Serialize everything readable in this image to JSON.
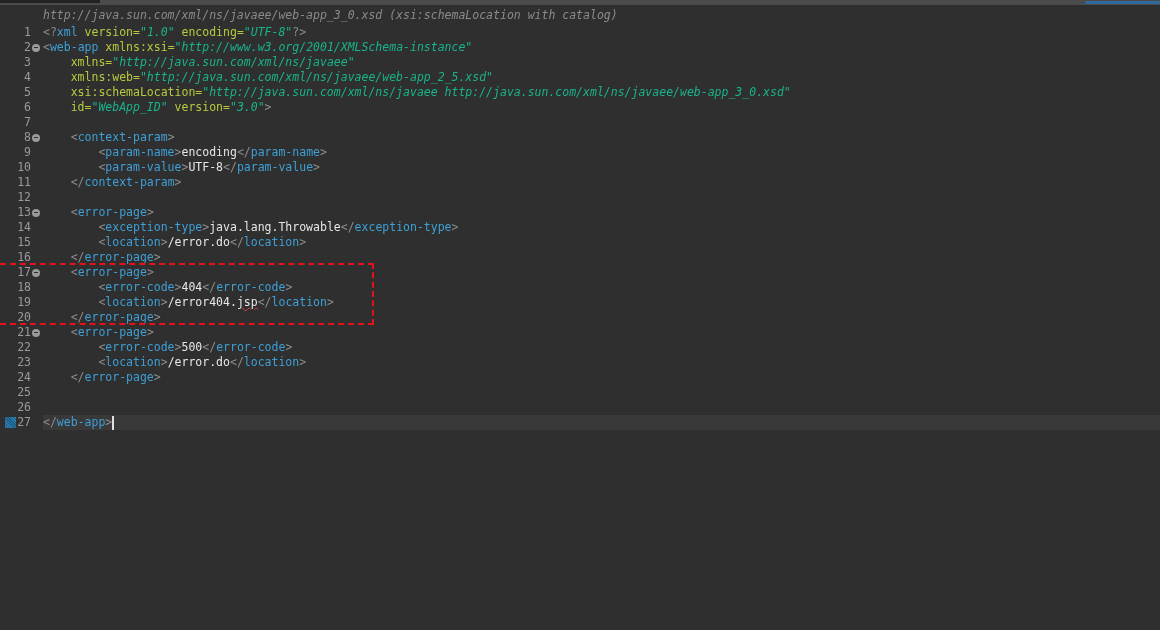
{
  "editor": {
    "hint": "http://java.sun.com/xml/ns/javaee/web-app_3_0.xsd (xsi:schemaLocation with catalog)",
    "lines": [
      {
        "number": "1",
        "foldable": false,
        "current": false,
        "bookmark": false,
        "tokens": [
          {
            "kind": "punct",
            "text": "<?"
          },
          {
            "kind": "tag",
            "text": "xml"
          },
          {
            "kind": "attr",
            "text": " version="
          },
          {
            "kind": "value",
            "text": "\"1.0\""
          },
          {
            "kind": "attr",
            "text": " encoding="
          },
          {
            "kind": "value",
            "text": "\"UTF-8\""
          },
          {
            "kind": "punct",
            "text": "?>"
          }
        ]
      },
      {
        "number": "2",
        "foldable": true,
        "current": false,
        "bookmark": false,
        "tokens": [
          {
            "kind": "punct",
            "text": "<"
          },
          {
            "kind": "tag",
            "text": "web-app"
          },
          {
            "kind": "attr",
            "text": " xmlns:xsi="
          },
          {
            "kind": "value",
            "text": "\"http://www.w3.org/2001/XMLSchema-instance\""
          }
        ]
      },
      {
        "number": "3",
        "foldable": false,
        "current": false,
        "bookmark": false,
        "tokens": [
          {
            "kind": "attr",
            "text": "    xmlns="
          },
          {
            "kind": "value",
            "text": "\"http://java.sun.com/xml/ns/javaee\""
          }
        ]
      },
      {
        "number": "4",
        "foldable": false,
        "current": false,
        "bookmark": false,
        "tokens": [
          {
            "kind": "attr",
            "text": "    xmlns:web="
          },
          {
            "kind": "value",
            "text": "\"http://java.sun.com/xml/ns/javaee/web-app_2_5.xsd\""
          }
        ]
      },
      {
        "number": "5",
        "foldable": false,
        "current": false,
        "bookmark": false,
        "tokens": [
          {
            "kind": "attr",
            "text": "    xsi:schemaLocation="
          },
          {
            "kind": "value",
            "text": "\"http://java.sun.com/xml/ns/javaee http://java.sun.com/xml/ns/javaee/web-app_3_0.xsd\""
          }
        ]
      },
      {
        "number": "6",
        "foldable": false,
        "current": false,
        "bookmark": false,
        "tokens": [
          {
            "kind": "attr",
            "text": "    id="
          },
          {
            "kind": "value",
            "text": "\"WebApp_ID\""
          },
          {
            "kind": "attr",
            "text": " version="
          },
          {
            "kind": "value",
            "text": "\"3.0\""
          },
          {
            "kind": "punct",
            "text": ">"
          }
        ]
      },
      {
        "number": "7",
        "foldable": false,
        "current": false,
        "bookmark": false
      },
      {
        "number": "8",
        "foldable": true,
        "current": false,
        "bookmark": false,
        "tokens": [
          {
            "kind": "punct",
            "text": "    <"
          },
          {
            "kind": "tag",
            "text": "context-param"
          },
          {
            "kind": "punct",
            "text": ">"
          }
        ]
      },
      {
        "number": "9",
        "foldable": false,
        "current": false,
        "bookmark": false,
        "tokens": [
          {
            "kind": "punct",
            "text": "        <"
          },
          {
            "kind": "tag",
            "text": "param-name"
          },
          {
            "kind": "punct",
            "text": ">"
          },
          {
            "kind": "text",
            "text": "encoding"
          },
          {
            "kind": "punct",
            "text": "</"
          },
          {
            "kind": "tag",
            "text": "param-name"
          },
          {
            "kind": "punct",
            "text": ">"
          }
        ]
      },
      {
        "number": "10",
        "foldable": false,
        "current": false,
        "bookmark": false,
        "tokens": [
          {
            "kind": "punct",
            "text": "        <"
          },
          {
            "kind": "tag",
            "text": "param-value"
          },
          {
            "kind": "punct",
            "text": ">"
          },
          {
            "kind": "text",
            "text": "UTF-8"
          },
          {
            "kind": "punct",
            "text": "</"
          },
          {
            "kind": "tag",
            "text": "param-value"
          },
          {
            "kind": "punct",
            "text": ">"
          }
        ]
      },
      {
        "number": "11",
        "foldable": false,
        "current": false,
        "bookmark": false,
        "tokens": [
          {
            "kind": "punct",
            "text": "    </"
          },
          {
            "kind": "tag",
            "text": "context-param"
          },
          {
            "kind": "punct",
            "text": ">"
          }
        ]
      },
      {
        "number": "12",
        "foldable": false,
        "current": false,
        "bookmark": false
      },
      {
        "number": "13",
        "foldable": true,
        "current": false,
        "bookmark": false,
        "tokens": [
          {
            "kind": "punct",
            "text": "    <"
          },
          {
            "kind": "tag",
            "text": "error-page"
          },
          {
            "kind": "punct",
            "text": ">"
          }
        ]
      },
      {
        "number": "14",
        "foldable": false,
        "current": false,
        "bookmark": false,
        "tokens": [
          {
            "kind": "punct",
            "text": "        <"
          },
          {
            "kind": "tag",
            "text": "exception-type"
          },
          {
            "kind": "punct",
            "text": ">"
          },
          {
            "kind": "text",
            "text": "java.lang.Throwable"
          },
          {
            "kind": "punct",
            "text": "</"
          },
          {
            "kind": "tag",
            "text": "exception-type"
          },
          {
            "kind": "punct",
            "text": ">"
          }
        ]
      },
      {
        "number": "15",
        "foldable": false,
        "current": false,
        "bookmark": false,
        "tokens": [
          {
            "kind": "punct",
            "text": "        <"
          },
          {
            "kind": "tag",
            "text": "location"
          },
          {
            "kind": "punct",
            "text": ">"
          },
          {
            "kind": "text",
            "text": "/error.do"
          },
          {
            "kind": "punct",
            "text": "</"
          },
          {
            "kind": "tag",
            "text": "location"
          },
          {
            "kind": "punct",
            "text": ">"
          }
        ]
      },
      {
        "number": "16",
        "foldable": false,
        "current": false,
        "bookmark": false,
        "tokens": [
          {
            "kind": "punct",
            "text": "    </"
          },
          {
            "kind": "tag",
            "text": "error-page"
          },
          {
            "kind": "punct",
            "text": ">"
          }
        ]
      },
      {
        "number": "17",
        "foldable": true,
        "current": false,
        "bookmark": false,
        "tokens": [
          {
            "kind": "punct",
            "text": "    <"
          },
          {
            "kind": "tag",
            "text": "error-page"
          },
          {
            "kind": "punct",
            "text": ">"
          }
        ]
      },
      {
        "number": "18",
        "foldable": false,
        "current": false,
        "bookmark": false,
        "tokens": [
          {
            "kind": "punct",
            "text": "        <"
          },
          {
            "kind": "tag",
            "text": "error-code"
          },
          {
            "kind": "punct",
            "text": ">"
          },
          {
            "kind": "text",
            "text": "404"
          },
          {
            "kind": "punct",
            "text": "</"
          },
          {
            "kind": "tag",
            "text": "error-code"
          },
          {
            "kind": "punct",
            "text": ">"
          }
        ]
      },
      {
        "number": "19",
        "foldable": false,
        "current": false,
        "bookmark": false,
        "tokens": [
          {
            "kind": "punct",
            "text": "        <"
          },
          {
            "kind": "tag",
            "text": "location"
          },
          {
            "kind": "punct",
            "text": ">"
          },
          {
            "kind": "text",
            "text": "/error404."
          },
          {
            "kind": "misspelled",
            "text": "jsp"
          },
          {
            "kind": "punct",
            "text": "</"
          },
          {
            "kind": "tag",
            "text": "location"
          },
          {
            "kind": "punct",
            "text": ">"
          }
        ]
      },
      {
        "number": "20",
        "foldable": false,
        "current": false,
        "bookmark": false,
        "tokens": [
          {
            "kind": "punct",
            "text": "    </"
          },
          {
            "kind": "tag",
            "text": "error-page"
          },
          {
            "kind": "punct",
            "text": ">"
          }
        ]
      },
      {
        "number": "21",
        "foldable": true,
        "current": false,
        "bookmark": false,
        "tokens": [
          {
            "kind": "punct",
            "text": "    <"
          },
          {
            "kind": "tag",
            "text": "error-page"
          },
          {
            "kind": "punct",
            "text": ">"
          }
        ]
      },
      {
        "number": "22",
        "foldable": false,
        "current": false,
        "bookmark": false,
        "tokens": [
          {
            "kind": "punct",
            "text": "        <"
          },
          {
            "kind": "tag",
            "text": "error-code"
          },
          {
            "kind": "punct",
            "text": ">"
          },
          {
            "kind": "text",
            "text": "500"
          },
          {
            "kind": "punct",
            "text": "</"
          },
          {
            "kind": "tag",
            "text": "error-code"
          },
          {
            "kind": "punct",
            "text": ">"
          }
        ]
      },
      {
        "number": "23",
        "foldable": false,
        "current": false,
        "bookmark": false,
        "tokens": [
          {
            "kind": "punct",
            "text": "        <"
          },
          {
            "kind": "tag",
            "text": "location"
          },
          {
            "kind": "punct",
            "text": ">"
          },
          {
            "kind": "text",
            "text": "/error.do"
          },
          {
            "kind": "punct",
            "text": "</"
          },
          {
            "kind": "tag",
            "text": "location"
          },
          {
            "kind": "punct",
            "text": ">"
          }
        ]
      },
      {
        "number": "24",
        "foldable": false,
        "current": false,
        "bookmark": false,
        "tokens": [
          {
            "kind": "punct",
            "text": "    </"
          },
          {
            "kind": "tag",
            "text": "error-page"
          },
          {
            "kind": "punct",
            "text": ">"
          }
        ]
      },
      {
        "number": "25",
        "foldable": false,
        "current": false,
        "bookmark": false
      },
      {
        "number": "26",
        "foldable": false,
        "current": false,
        "bookmark": false
      },
      {
        "number": "27",
        "foldable": false,
        "current": true,
        "bookmark": true,
        "tokens": [
          {
            "kind": "punct",
            "text": "</"
          },
          {
            "kind": "tag",
            "text": "web-app"
          },
          {
            "kind": "punct",
            "text": ">"
          }
        ]
      }
    ]
  }
}
